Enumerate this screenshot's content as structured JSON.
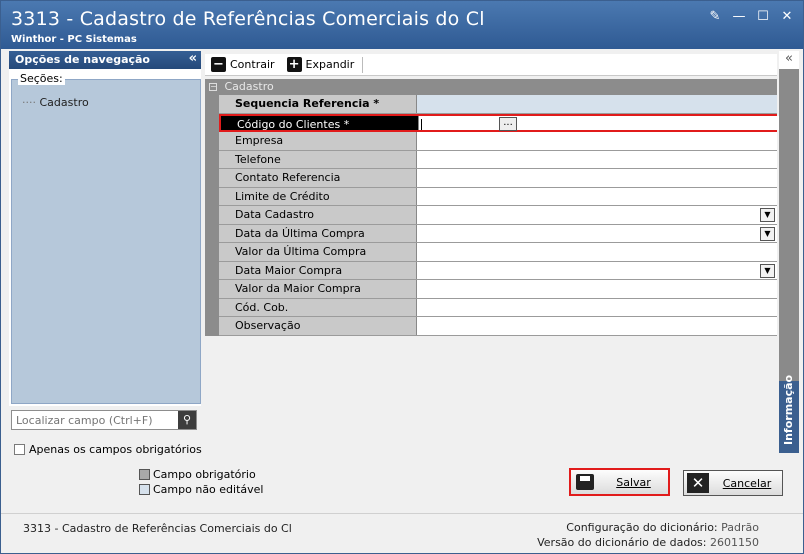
{
  "window": {
    "title": "3313 - Cadastro de Referências Comerciais do Cl",
    "subtitle": "Winthor - PC Sistemas",
    "controls": [
      "restore-edit",
      "minimize",
      "maximize",
      "close"
    ]
  },
  "nav": {
    "header": "Opções de navegação",
    "sections_legend": "Seções:",
    "items": [
      {
        "label": "Cadastro"
      }
    ],
    "search_placeholder": "Localizar campo (Ctrl+F)",
    "only_required_label": "Apenas os campos obrigatórios"
  },
  "legend": {
    "required_label": "Campo obrigatório",
    "required_color": "#a8a8a8",
    "readonly_label": "Campo não editável",
    "readonly_color": "#d6e1ec"
  },
  "toolbar": {
    "collapse_label": "Contrair",
    "expand_label": "Expandir"
  },
  "grid": {
    "category": "Cadastro",
    "rows": [
      {
        "label": "Sequencia Referencia *",
        "value": "",
        "type": "readonly",
        "bold": true
      },
      {
        "label": "Código do Clientes *",
        "value": "",
        "type": "ellipsis",
        "selected": true
      },
      {
        "label": "Empresa",
        "value": "",
        "type": "text"
      },
      {
        "label": "Telefone",
        "value": "",
        "type": "text"
      },
      {
        "label": "Contato Referencia",
        "value": "",
        "type": "text"
      },
      {
        "label": "Limite de Crédito",
        "value": "",
        "type": "text"
      },
      {
        "label": "Data Cadastro",
        "value": "",
        "type": "dropdown"
      },
      {
        "label": "Data da Última Compra",
        "value": "",
        "type": "dropdown"
      },
      {
        "label": "Valor da Última Compra",
        "value": "",
        "type": "text"
      },
      {
        "label": "Data Maior Compra",
        "value": "",
        "type": "dropdown"
      },
      {
        "label": "Valor da Maior Compra",
        "value": "",
        "type": "text"
      },
      {
        "label": "Cód. Cob.",
        "value": "",
        "type": "text"
      },
      {
        "label": "Observação",
        "value": "",
        "type": "text"
      }
    ]
  },
  "side_tab": {
    "label": "Informação"
  },
  "actions": {
    "save_label": "Salvar",
    "cancel_label": "Cancelar"
  },
  "footer": {
    "left": "3313 - Cadastro de Referências Comerciais do Cl",
    "dict_config_label": "Configuração do dicionário:",
    "dict_config_value": "Padrão",
    "dict_version_label": "Versão do dicionário de dados:",
    "dict_version_value": "2601150"
  }
}
